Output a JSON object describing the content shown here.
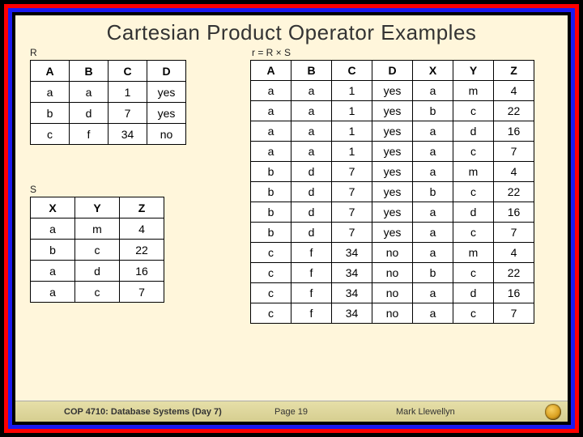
{
  "title": "Cartesian Product Operator Examples",
  "labels": {
    "R": "R",
    "S": "S",
    "result": "r = R × S"
  },
  "R": {
    "headers": [
      "A",
      "B",
      "C",
      "D"
    ],
    "rows": [
      [
        "a",
        "a",
        "1",
        "yes"
      ],
      [
        "b",
        "d",
        "7",
        "yes"
      ],
      [
        "c",
        "f",
        "34",
        "no"
      ]
    ]
  },
  "S": {
    "headers": [
      "X",
      "Y",
      "Z"
    ],
    "rows": [
      [
        "a",
        "m",
        "4"
      ],
      [
        "b",
        "c",
        "22"
      ],
      [
        "a",
        "d",
        "16"
      ],
      [
        "a",
        "c",
        "7"
      ]
    ]
  },
  "Result": {
    "headers": [
      "A",
      "B",
      "C",
      "D",
      "X",
      "Y",
      "Z"
    ],
    "rows": [
      [
        "a",
        "a",
        "1",
        "yes",
        "a",
        "m",
        "4"
      ],
      [
        "a",
        "a",
        "1",
        "yes",
        "b",
        "c",
        "22"
      ],
      [
        "a",
        "a",
        "1",
        "yes",
        "a",
        "d",
        "16"
      ],
      [
        "a",
        "a",
        "1",
        "yes",
        "a",
        "c",
        "7"
      ],
      [
        "b",
        "d",
        "7",
        "yes",
        "a",
        "m",
        "4"
      ],
      [
        "b",
        "d",
        "7",
        "yes",
        "b",
        "c",
        "22"
      ],
      [
        "b",
        "d",
        "7",
        "yes",
        "a",
        "d",
        "16"
      ],
      [
        "b",
        "d",
        "7",
        "yes",
        "a",
        "c",
        "7"
      ],
      [
        "c",
        "f",
        "34",
        "no",
        "a",
        "m",
        "4"
      ],
      [
        "c",
        "f",
        "34",
        "no",
        "b",
        "c",
        "22"
      ],
      [
        "c",
        "f",
        "34",
        "no",
        "a",
        "d",
        "16"
      ],
      [
        "c",
        "f",
        "34",
        "no",
        "a",
        "c",
        "7"
      ]
    ]
  },
  "footer": {
    "course": "COP 4710: Database Systems  (Day 7)",
    "page": "Page 19",
    "author": "Mark Llewellyn"
  }
}
